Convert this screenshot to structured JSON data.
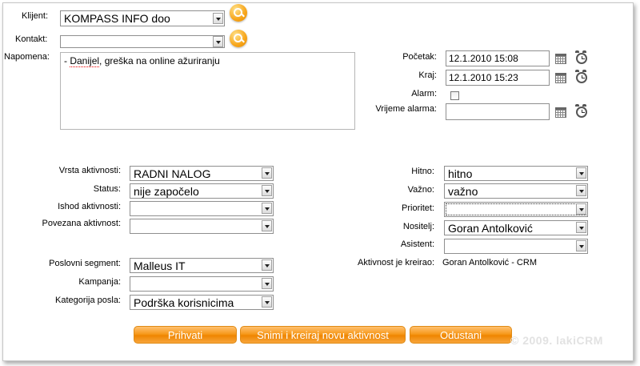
{
  "top": {
    "klijent_label": "Klijent:",
    "klijent_value": "KOMPASS INFO doo",
    "kontakt_label": "Kontakt:",
    "kontakt_value": "",
    "napomena_label": "Napomena:",
    "napomena_prefix": "- ",
    "napomena_word": "Danijel",
    "napomena_rest": ", greška na online ažuriranju"
  },
  "timing": {
    "pocetak_label": "Početak:",
    "pocetak_value": "12.1.2010 15:08",
    "kraj_label": "Kraj:",
    "kraj_value": "12.1.2010 15:23",
    "alarm_label": "Alarm:",
    "alarm_checked": false,
    "vrijeme_alarma_label": "Vrijeme alarma:",
    "vrijeme_alarma_value": ""
  },
  "left_fields": {
    "vrsta_label": "Vrsta aktivnosti:",
    "vrsta_value": "RADNI NALOG",
    "status_label": "Status:",
    "status_value": "nije započelo",
    "ishod_label": "Ishod aktivnosti:",
    "ishod_value": "",
    "povezana_label": "Povezana aktivnost:",
    "povezana_value": "",
    "segment_label": "Poslovni segment:",
    "segment_value": "Malleus IT",
    "kampanja_label": "Kampanja:",
    "kampanja_value": "",
    "kategorija_label": "Kategorija posla:",
    "kategorija_value": "Podrška korisnicima"
  },
  "right_fields": {
    "hitno_label": "Hitno:",
    "hitno_value": "hitno",
    "vazno_label": "Važno:",
    "vazno_value": "važno",
    "prioritet_label": "Prioritet:",
    "prioritet_value": "",
    "nositelj_label": "Nositelj:",
    "nositelj_value": "Goran Antolković",
    "asistent_label": "Asistent:",
    "asistent_value": "",
    "kreirao_label": "Aktivnost je kreirao:",
    "kreirao_value": "Goran Antolković - CRM"
  },
  "buttons": {
    "prihvati": "Prihvati",
    "snimi": "Snimi i kreiraj novu aktivnost",
    "odustani": "Odustani"
  },
  "footer": {
    "copyright": "© 2009. lakiCRM"
  },
  "colors": {
    "button_orange": "#f79a1c",
    "copyright_gray": "#e2e2e2"
  }
}
